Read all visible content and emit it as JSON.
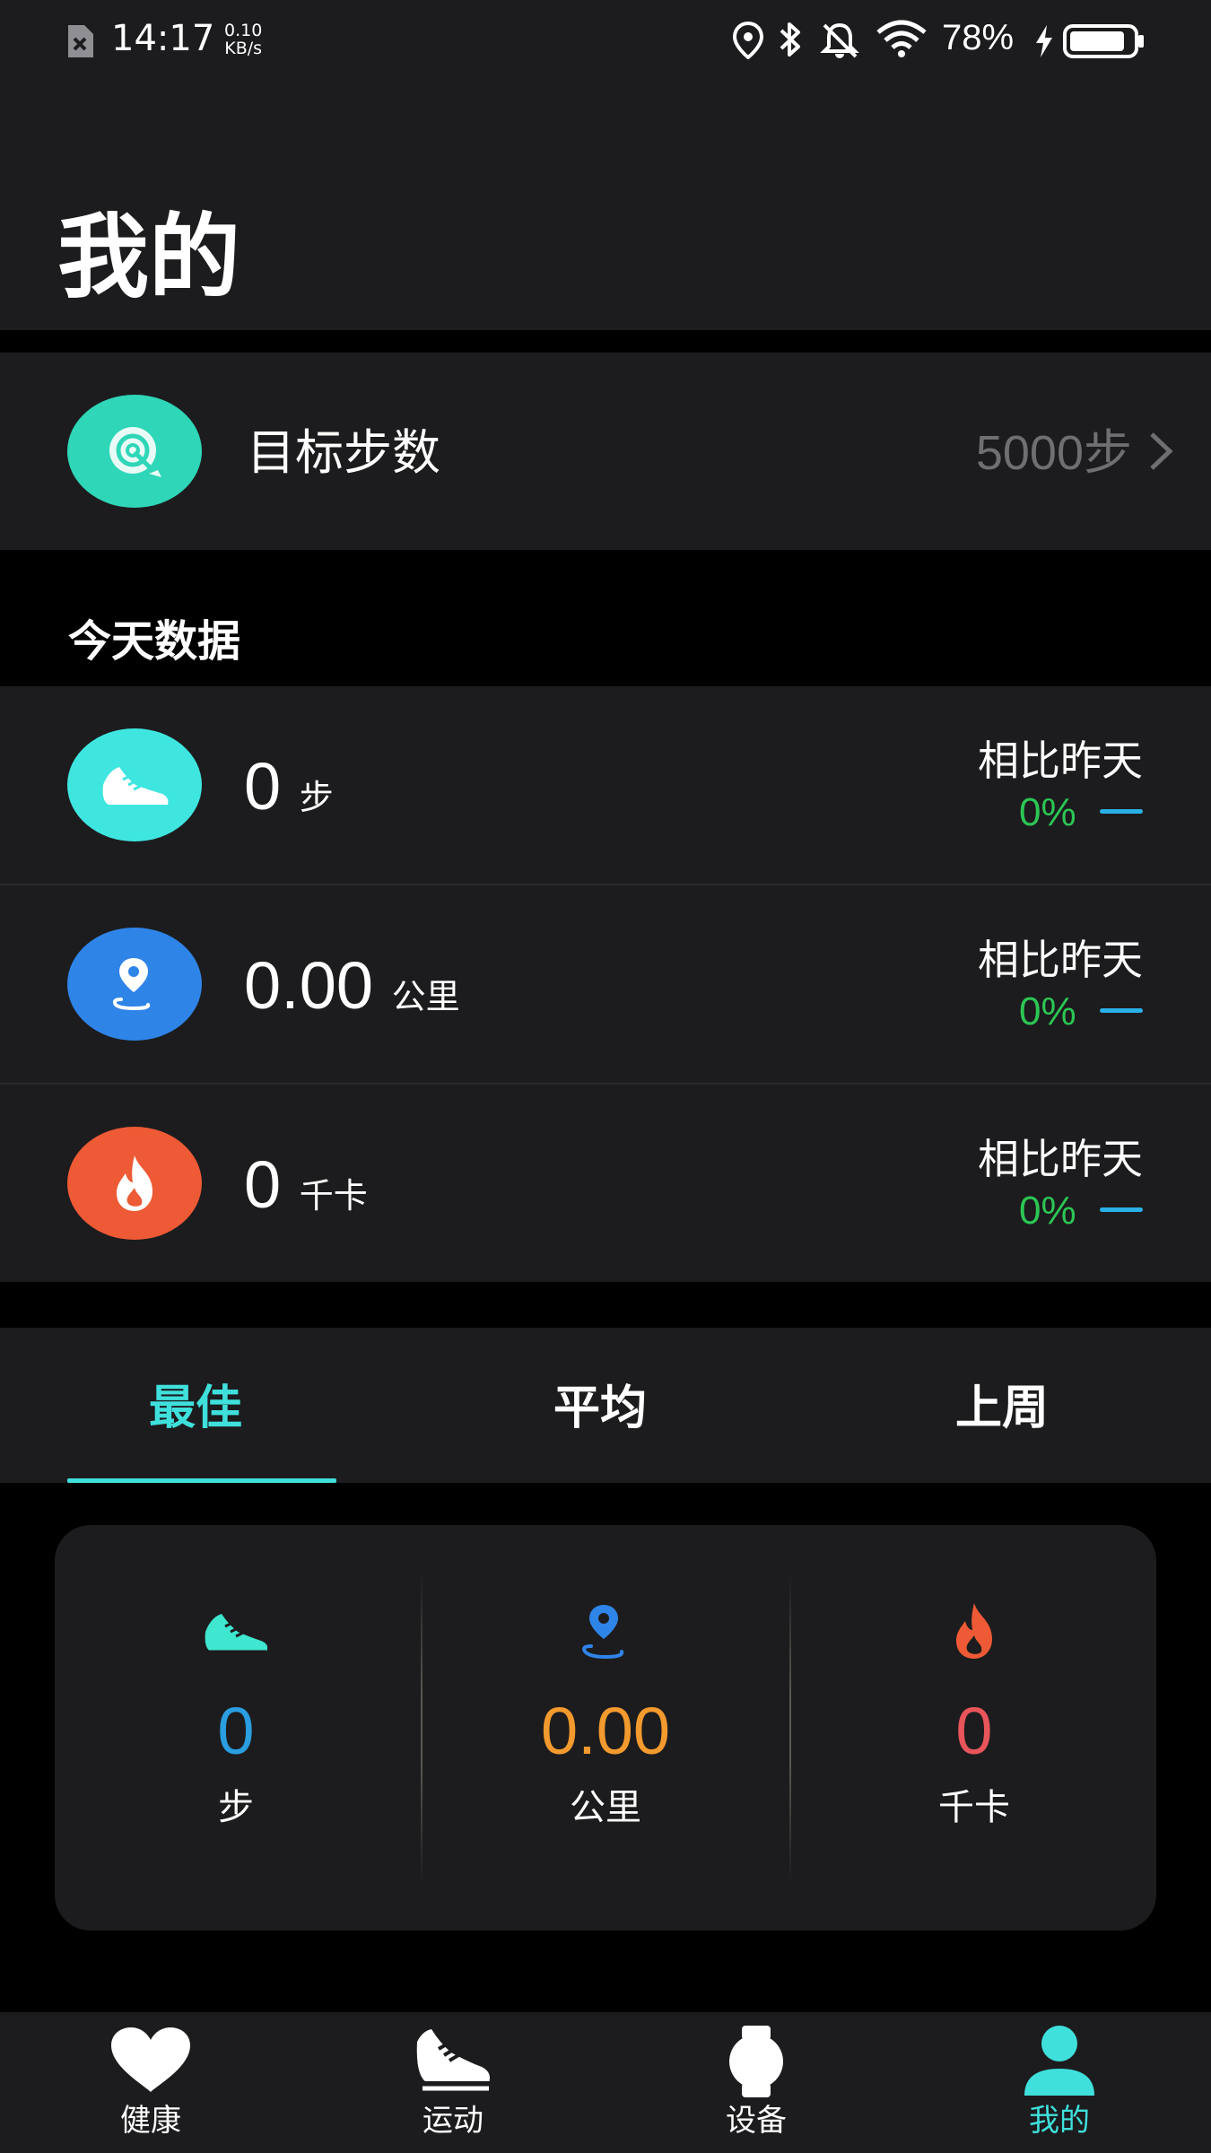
{
  "status_bar": {
    "time": "14:17",
    "net_speed_value": "0.10",
    "net_speed_unit": "KB/s",
    "battery": "78%",
    "icons": [
      "sim-off-icon",
      "location-icon",
      "bluetooth-icon",
      "mute-bell-icon",
      "wifi-icon",
      "charging-icon",
      "battery-icon"
    ]
  },
  "header": {
    "title": "我的"
  },
  "goal": {
    "icon": "target-icon",
    "icon_color": "#2fd6b8",
    "label": "目标步数",
    "value": "5000步"
  },
  "today": {
    "title": "今天数据",
    "rows": [
      {
        "icon": "shoe-icon",
        "icon_color": "#3fe6e0",
        "value": "0",
        "unit": "步",
        "compare_label": "相比昨天",
        "compare_pct": "0%"
      },
      {
        "icon": "route-icon",
        "icon_color": "#2f84e8",
        "value": "0.00",
        "unit": "公里",
        "compare_label": "相比昨天",
        "compare_pct": "0%"
      },
      {
        "icon": "flame-icon",
        "icon_color": "#ee5a35",
        "value": "0",
        "unit": "千卡",
        "compare_label": "相比昨天",
        "compare_pct": "0%"
      }
    ]
  },
  "tabs": {
    "items": [
      {
        "label": "最佳",
        "active": true
      },
      {
        "label": "平均",
        "active": false
      },
      {
        "label": "上周",
        "active": false
      }
    ],
    "accent": "#3fe0dc"
  },
  "best": {
    "items": [
      {
        "icon": "shoe-icon",
        "value": "0",
        "unit": "步",
        "value_color": "#2a9ee0"
      },
      {
        "icon": "route-icon",
        "value": "0.00",
        "unit": "公里",
        "value_color": "#f39a2e"
      },
      {
        "icon": "flame-icon",
        "value": "0",
        "unit": "千卡",
        "value_color": "#e8555a"
      }
    ]
  },
  "bottom_nav": {
    "items": [
      {
        "label": "健康",
        "icon": "heart-icon",
        "active": false
      },
      {
        "label": "运动",
        "icon": "shoe-icon",
        "active": false
      },
      {
        "label": "设备",
        "icon": "watch-icon",
        "active": false
      },
      {
        "label": "我的",
        "icon": "person-icon",
        "active": true
      }
    ],
    "active_color": "#3fe0dc"
  }
}
